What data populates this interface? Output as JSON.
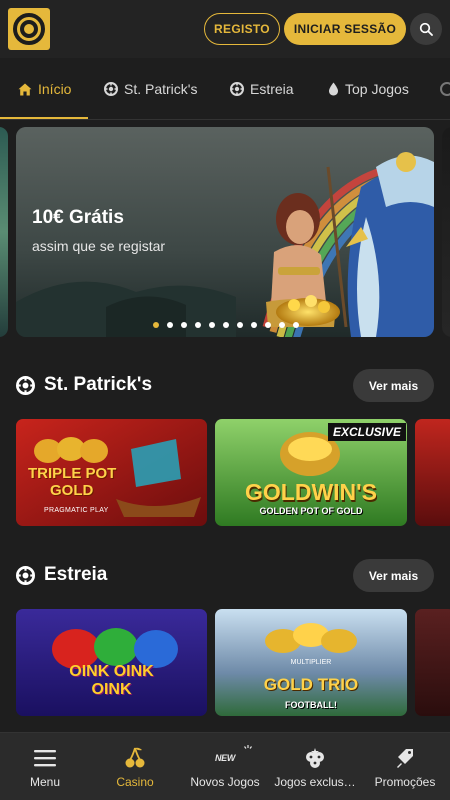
{
  "header": {
    "register_label": "REGISTO",
    "login_label": "INICIAR SESSÃO",
    "search_icon": "search-icon",
    "brand_color": "#e5b83b"
  },
  "tabs": [
    {
      "label": "Início",
      "icon": "home-icon",
      "active": true
    },
    {
      "label": "St. Patrick's",
      "icon": "chip-icon"
    },
    {
      "label": "Estreia",
      "icon": "chip-icon"
    },
    {
      "label": "Top Jogos",
      "icon": "drop-icon"
    }
  ],
  "banner": {
    "title": "10€ Grátis",
    "subtitle": "assim que se registar",
    "slide_count": 11,
    "active_slide": 1
  },
  "sections": [
    {
      "title": "St. Patrick's",
      "more_label": "Ver mais",
      "games": [
        {
          "title_line1": "TRIPLE POT",
          "title_line2": "GOLD",
          "provider": "PRAGMATIC PLAY"
        },
        {
          "title": "GOLDWIN'S",
          "subtitle": "GOLDEN POT OF GOLD",
          "badge": "EXCLUSIVE"
        }
      ]
    },
    {
      "title": "Estreia",
      "more_label": "Ver mais",
      "games": [
        {
          "title_line1": "OINK OINK",
          "title_line2": "OINK"
        },
        {
          "tag": "MULTIPLIER",
          "title": "GOLD TRIO",
          "subtitle": "FOOTBALL!"
        }
      ]
    }
  ],
  "bottom_nav": [
    {
      "label": "Menu",
      "icon": "menu-icon"
    },
    {
      "label": "Casino",
      "icon": "cherries-icon",
      "active": true
    },
    {
      "label": "Novos Jogos",
      "icon": "new-icon",
      "badge": "NEW"
    },
    {
      "label": "Jogos exclus…",
      "icon": "dice-icon"
    },
    {
      "label": "Promoções",
      "icon": "tag-icon"
    }
  ]
}
